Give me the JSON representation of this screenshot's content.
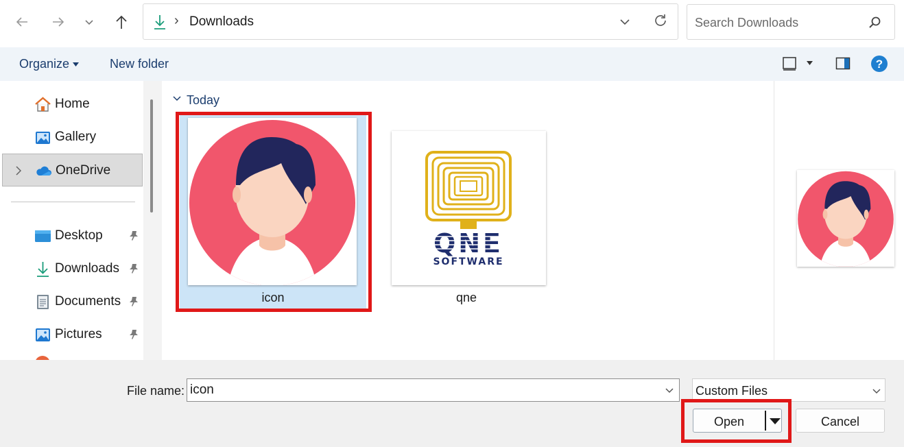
{
  "address_bar": {
    "location_icon": "downloads-arrow-icon",
    "separator": "›",
    "path": "Downloads"
  },
  "search": {
    "placeholder": "Search Downloads",
    "icon": "search-icon"
  },
  "toolbar": {
    "organize_label": "Organize",
    "new_folder_label": "New folder"
  },
  "sidebar": {
    "items": [
      {
        "label": "Home",
        "icon": "home-icon"
      },
      {
        "label": "Gallery",
        "icon": "gallery-icon"
      },
      {
        "label": "OneDrive",
        "icon": "cloud-icon"
      },
      {
        "label": "Desktop",
        "icon": "desktop-icon"
      },
      {
        "label": "Downloads",
        "icon": "downloads-icon"
      },
      {
        "label": "Documents",
        "icon": "documents-icon"
      },
      {
        "label": "Pictures",
        "icon": "pictures-icon"
      }
    ]
  },
  "content": {
    "group_label": "Today",
    "files": [
      {
        "name": "icon",
        "selected": true
      },
      {
        "name": "qne",
        "selected": false
      }
    ],
    "qne_logo": {
      "line1": "QNE",
      "line2": "SOFTWARE"
    }
  },
  "footer": {
    "file_name_label": "File name:",
    "file_name_value": "icon",
    "file_type": "Custom Files",
    "open_label": "Open",
    "cancel_label": "Cancel"
  },
  "colors": {
    "accent": "#0067c0",
    "highlight_box": "#e01818",
    "selection": "#cce4f7",
    "avatar_circle": "#f1566c",
    "avatar_hair": "#22265c",
    "qne_gold": "#e0b11a",
    "qne_navy": "#1f2e6e"
  }
}
